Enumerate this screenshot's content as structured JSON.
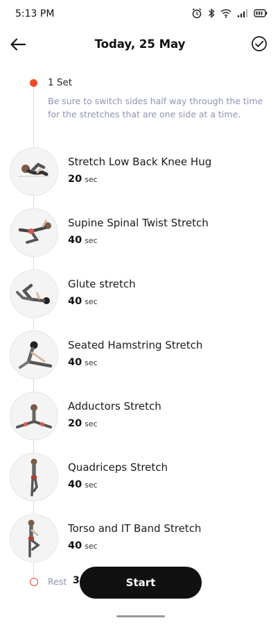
{
  "status_bar": {
    "time": "5:13 PM"
  },
  "header": {
    "title": "Today, 25 May"
  },
  "set": {
    "label": "1 Set",
    "note": "Be sure to switch sides half way through the time for the stretches that are one side at a time."
  },
  "exercises": [
    {
      "name": "Stretch Low Back Knee Hug",
      "duration": "20",
      "unit": "sec"
    },
    {
      "name": "Supine Spinal Twist Stretch",
      "duration": "40",
      "unit": "sec"
    },
    {
      "name": "Glute stretch",
      "duration": "40",
      "unit": "sec"
    },
    {
      "name": "Seated Hamstring Stretch",
      "duration": "40",
      "unit": "sec"
    },
    {
      "name": "Adductors Stretch",
      "duration": "20",
      "unit": "sec"
    },
    {
      "name": "Quadriceps Stretch",
      "duration": "40",
      "unit": "sec"
    },
    {
      "name": "Torso and IT Band Stretch",
      "duration": "40",
      "unit": "sec"
    }
  ],
  "rest": {
    "label": "Rest",
    "value": "3"
  },
  "start_button": {
    "label": "Start"
  },
  "colors": {
    "accent": "#f2472a",
    "note_text": "#8e93b3",
    "button_bg": "#111111"
  },
  "icons": [
    "alarm-icon",
    "bluetooth-icon",
    "wifi-icon",
    "signal-icon",
    "battery-icon",
    "back-arrow-icon",
    "check-circle-icon"
  ]
}
